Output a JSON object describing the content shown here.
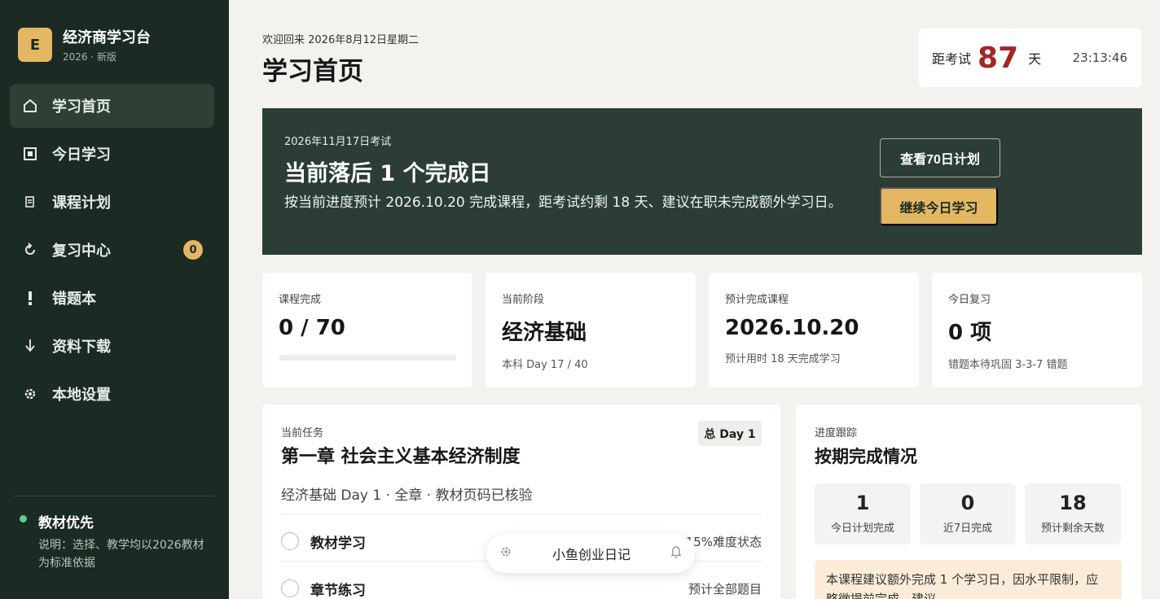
{
  "brand": {
    "logo": "E",
    "title": "经济商学习台",
    "subtitle": "2026 · 新版"
  },
  "nav": [
    {
      "label": "学习首页",
      "icon": "home-icon",
      "active": true
    },
    {
      "label": "今日学习",
      "icon": "square-icon"
    },
    {
      "label": "课程计划",
      "icon": "list-icon"
    },
    {
      "label": "复习中心",
      "icon": "refresh-icon",
      "badge": "0"
    },
    {
      "label": "错题本",
      "icon": "exclamation-icon"
    },
    {
      "label": "资料下载",
      "icon": "download-icon"
    },
    {
      "label": "本地设置",
      "icon": "gear-icon"
    }
  ],
  "note": {
    "title": "教材优先",
    "text": "说明：选择、教学均以2026教材为标准依据"
  },
  "header": {
    "welcome": "欢迎回来 2026年8月12日星期二",
    "title": "学习首页",
    "countdown_label": "距考试",
    "countdown_num": "87",
    "countdown_unit": "天",
    "time": "23:13:46"
  },
  "banner": {
    "date": "2026年11月17日考试",
    "title": "当前落后 1 个完成日",
    "desc": "按当前进度预计 2026.10.20 完成课程，距考试约剩 18 天、建议在职未完成额外学习日。",
    "btn_plan": "查看70日计划",
    "btn_continue": "继续今日学习"
  },
  "stats": [
    {
      "label": "课程完成",
      "value": "0 / 70",
      "progress": 0
    },
    {
      "label": "当前阶段",
      "value": "经济基础",
      "sub": "本科 Day 17 / 40"
    },
    {
      "label": "预计完成课程",
      "value": "2026.10.20",
      "sub": "预计用时 18 天完成学习"
    },
    {
      "label": "今日复习",
      "value": "0 项",
      "sub": "错题本待巩固 3-3-7 错题"
    }
  ],
  "task": {
    "label": "当前任务",
    "title": "第一章 社会主义基本经济制度",
    "day": "总 Day 1",
    "desc": "经济基础 Day 1 · 全章 · 教材页码已核验",
    "rows": [
      {
        "name": "教材学习",
        "right": "15%难度状态"
      },
      {
        "name": "章节练习",
        "right": "预计全部题目"
      }
    ]
  },
  "progress": {
    "label": "进度跟踪",
    "title": "按期完成情况",
    "metrics": [
      {
        "num": "1",
        "label": "今日计划完成"
      },
      {
        "num": "0",
        "label": "近7日完成"
      },
      {
        "num": "18",
        "label": "预计剩余天数"
      }
    ],
    "note": "本课程建议额外完成 1 个学习日，因水平限制，应略微提前完成，建议…"
  },
  "pill": {
    "text": "小鱼创业日记",
    "left_icon": "gear-icon",
    "right_icon": "bell-icon"
  },
  "colors": {
    "sidebar": "#1b2a22",
    "banner": "#2b3d34",
    "accent": "#e4b763",
    "countdown": "#a02727"
  }
}
